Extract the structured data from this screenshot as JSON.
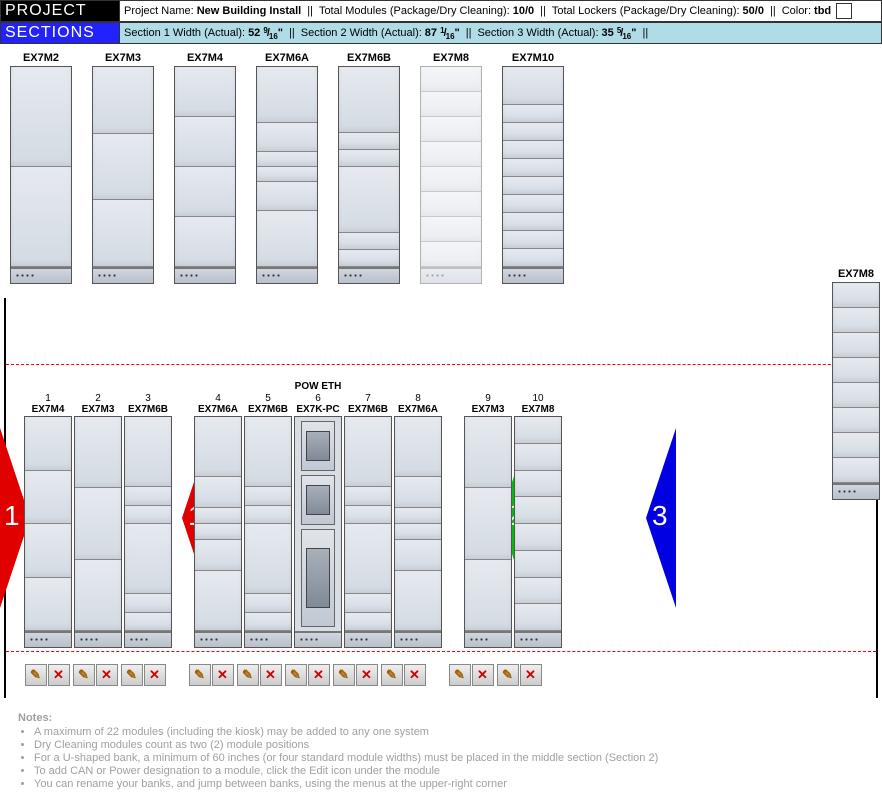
{
  "project_bar": {
    "label": "PROJECT",
    "name_label": "Project Name:",
    "name_value": "New Building Install",
    "mods_label": "Total Modules (Package/Dry Cleaning):",
    "mods_value": "10/0",
    "lockers_label": "Total Lockers (Package/Dry Cleaning):",
    "lockers_value": "50/0",
    "color_label": "Color:",
    "color_value": "tbd"
  },
  "sections_bar": {
    "label": "SECTIONS",
    "s1_label": "Section 1 Width (Actual):",
    "s1_val_whole": "52",
    "s1_val_num": "9",
    "s1_val_den": "16",
    "s1_val_unit": "\"",
    "s2_label": "Section 2 Width (Actual):",
    "s2_val_whole": "87",
    "s2_val_num": "1",
    "s2_val_den": "16",
    "s2_val_unit": "\"",
    "s3_label": "Section 3 Width (Actual):",
    "s3_val_whole": "35",
    "s3_val_num": "5",
    "s3_val_den": "16",
    "s3_val_unit": "\""
  },
  "palette": [
    {
      "code": "EX7M2",
      "doors": 2,
      "faded": false
    },
    {
      "code": "EX7M3",
      "doors": 3,
      "faded": false
    },
    {
      "code": "EX7M4",
      "doors": 4,
      "faded": false
    },
    {
      "code": "EX7M6A",
      "doors": 6,
      "faded": false,
      "pattern": "A"
    },
    {
      "code": "EX7M6B",
      "doors": 6,
      "faded": false,
      "pattern": "B"
    },
    {
      "code": "EX7M8",
      "doors": 8,
      "faded": true
    },
    {
      "code": "EX7M10",
      "doors": 10,
      "faded": false
    }
  ],
  "floating": {
    "code": "EX7M8",
    "doors": 8
  },
  "layout": {
    "sections": [
      {
        "id": 1,
        "slots": [
          {
            "n": "1",
            "code": "EX7M4",
            "doors": 4
          },
          {
            "n": "2",
            "code": "EX7M3",
            "doors": 3
          },
          {
            "n": "3",
            "code": "EX7M6B",
            "doors": 6,
            "pattern": "B"
          }
        ]
      },
      {
        "id": 2,
        "slots": [
          {
            "n": "4",
            "code": "EX7M6A",
            "doors": 6,
            "pattern": "A"
          },
          {
            "n": "5",
            "code": "EX7M6B",
            "doors": 6,
            "pattern": "B"
          },
          {
            "n": "6",
            "code": "EX7K-PC",
            "kiosk": true,
            "pow": "POW ETH"
          },
          {
            "n": "7",
            "code": "EX7M6B",
            "doors": 6,
            "pattern": "B"
          },
          {
            "n": "8",
            "code": "EX7M6A",
            "doors": 6,
            "pattern": "A"
          }
        ]
      },
      {
        "id": 3,
        "slots": [
          {
            "n": "9",
            "code": "EX7M3",
            "doors": 3
          },
          {
            "n": "10",
            "code": "EX7M8",
            "doors": 8
          }
        ]
      }
    ]
  },
  "marker_labels": {
    "s1": "1",
    "s2": "2",
    "s3": "3"
  },
  "notes": {
    "title": "Notes:",
    "items": [
      "A maximum of 22 modules (including the kiosk) may be added to any one system",
      "Dry Cleaning modules count as two (2) module positions",
      "For a U-shaped bank, a minimum of 60 inches (or four standard module widths) must be placed in the middle section (Section 2)",
      "To add CAN or Power designation to a module, click the Edit icon under the module",
      "You can rename your banks, and jump between banks, using the menus at the upper-right corner"
    ]
  }
}
